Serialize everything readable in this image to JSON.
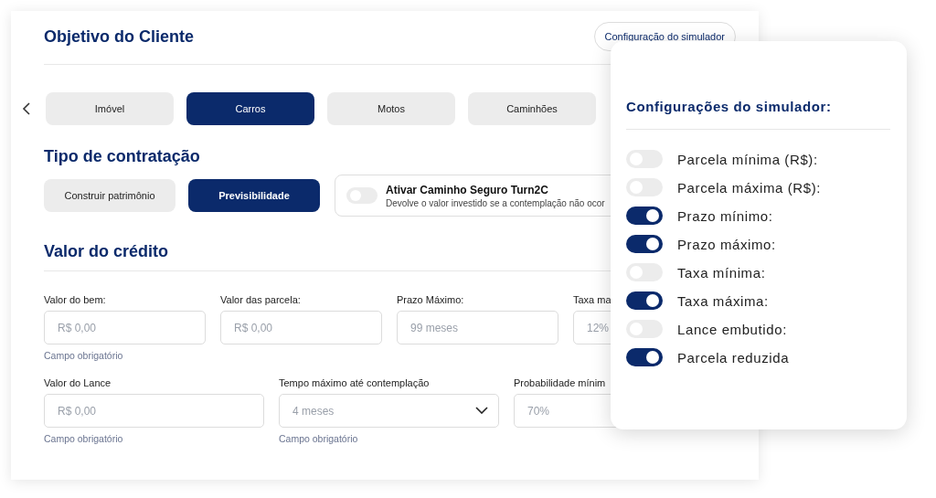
{
  "header": {
    "title": "Objetivo do Cliente",
    "config_button": "Configuração do simulador"
  },
  "categories": [
    {
      "label": "Imóvel",
      "selected": false
    },
    {
      "label": "Carros",
      "selected": true
    },
    {
      "label": "Motos",
      "selected": false
    },
    {
      "label": "Caminhões",
      "selected": false
    }
  ],
  "contract": {
    "title": "Tipo de contratação",
    "options": [
      {
        "label": "Construir patrimônio",
        "selected": false
      },
      {
        "label": "Previsibilidade",
        "selected": true
      }
    ],
    "insurance": {
      "title": "Ativar Caminho Seguro Turn2C",
      "description": "Devolve o valor investido se a contemplação não ocor",
      "on": false
    }
  },
  "credit": {
    "title": "Valor do crédito",
    "fields_top": [
      {
        "label": "Valor do bem:",
        "placeholder": "R$ 0,00",
        "kind": "input",
        "helper": "Campo obrigatório"
      },
      {
        "label": "Valor das parcela:",
        "placeholder": "R$ 0,00",
        "kind": "input"
      },
      {
        "label": "Prazo Máximo:",
        "placeholder": "99 meses",
        "kind": "input"
      },
      {
        "label": "Taxa ma",
        "placeholder": "12%",
        "kind": "input"
      }
    ],
    "fields_bottom": [
      {
        "label": "Valor do Lance",
        "placeholder": "R$ 0,00",
        "kind": "input",
        "helper": "Campo obrigatório"
      },
      {
        "label": "Tempo máximo até contemplação",
        "placeholder": "4 meses",
        "kind": "select",
        "helper": "Campo obrigatório"
      },
      {
        "label": "Probabilidade mínim",
        "placeholder": "70%",
        "kind": "input"
      }
    ]
  },
  "settings": {
    "title": "Configurações do simulador:",
    "options": [
      {
        "label": "Parcela mínima (R$):",
        "on": false
      },
      {
        "label": "Parcela máxima (R$):",
        "on": false
      },
      {
        "label": "Prazo mínimo:",
        "on": true
      },
      {
        "label": "Prazo máximo:",
        "on": true
      },
      {
        "label": "Taxa mínima:",
        "on": false
      },
      {
        "label": "Taxa máxima:",
        "on": true
      },
      {
        "label": "Lance embutido:",
        "on": false
      },
      {
        "label": "Parcela reduzida",
        "on": true
      }
    ]
  }
}
